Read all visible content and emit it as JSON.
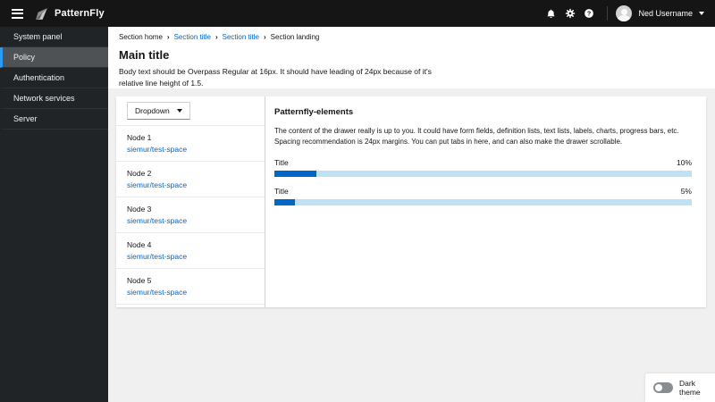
{
  "masthead": {
    "brand": "PatternFly",
    "user_name": "Ned Username"
  },
  "sidebar": {
    "items": [
      {
        "label": "System panel",
        "selected": false
      },
      {
        "label": "Policy",
        "selected": true
      },
      {
        "label": "Authentication",
        "selected": false
      },
      {
        "label": "Network services",
        "selected": false
      },
      {
        "label": "Server",
        "selected": false
      }
    ]
  },
  "breadcrumb": {
    "items": [
      {
        "label": "Section home",
        "type": "text"
      },
      {
        "label": "Section title",
        "type": "link"
      },
      {
        "label": "Section title",
        "type": "link"
      },
      {
        "label": "Section landing",
        "type": "current"
      }
    ],
    "separator": "›"
  },
  "page": {
    "title": "Main title",
    "body": "Body text should be Overpass Regular at 16px. It should have leading of 24px because of it's relative line height of 1.5."
  },
  "panel": {
    "dropdown_label": "Dropdown",
    "nodes": [
      {
        "name": "Node 1",
        "link": "siemur/test-space"
      },
      {
        "name": "Node 2",
        "link": "siemur/test-space"
      },
      {
        "name": "Node 3",
        "link": "siemur/test-space"
      },
      {
        "name": "Node 4",
        "link": "siemur/test-space"
      },
      {
        "name": "Node 5",
        "link": "siemur/test-space"
      }
    ]
  },
  "drawer": {
    "title": "Patternfly-elements",
    "body": "The content of the drawer really is up to you. It could have form fields, definition lists, text lists, labels, charts, progress bars, etc. Spacing recommendation is 24px margins. You can put tabs in here, and can also make the drawer scrollable.",
    "progress": [
      {
        "label": "Title",
        "value": "10%",
        "percent": 10
      },
      {
        "label": "Title",
        "value": "5%",
        "percent": 5
      }
    ]
  },
  "theme_toggle": {
    "label": "Dark theme",
    "state": "off"
  },
  "colors": {
    "link": "#0066cc",
    "progress_fill": "#0066cc",
    "progress_track": "#bee1f3",
    "nav_selected_accent": "#2b9af3",
    "masthead_bg": "#151515",
    "sidebar_bg": "#212427"
  }
}
